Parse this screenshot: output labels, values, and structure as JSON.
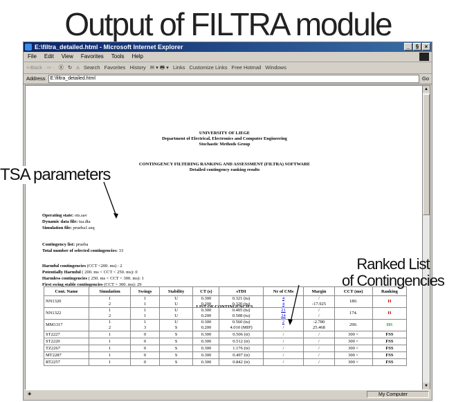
{
  "slide_title": "Output of FILTRA module",
  "window": {
    "title": "E:\\filtra_detailed.html - Microsoft Internet Explorer",
    "min": "_",
    "max": "§",
    "close": "×"
  },
  "menu": [
    "File",
    "Edit",
    "View",
    "Favorites",
    "Tools",
    "Help"
  ],
  "toolbar": {
    "back": "⇦Back · ⇨ ·",
    "stop": "Ⓧ",
    "refresh": "↻",
    "home": "⌂",
    "search": "Search",
    "favorites": "Favorites",
    "history": "History",
    "links": "Links",
    "customize": "Customize Links",
    "hotmail": "Free Hotmail",
    "windows": "Windows"
  },
  "address": {
    "label": "Address",
    "value": "E:\\filtra_detailed.html",
    "go": "Go"
  },
  "page": {
    "header1": "UNIVERSITY OF LIEGE",
    "header2": "Department of Electrical, Electronics and Computer Engineering",
    "header3": "Stochastic Methods Group",
    "software": "CONTINGENCY FILTERING RANKING AND ASSESSMENT (FILTRA) SOFTWARE",
    "subtitle": "Detailed contingency ranking results",
    "op_state_label": "Operating state:",
    "op_state_value": "ots.sav",
    "dyn_label": "Dynamic data file:",
    "dyn_value": "tsa.dta",
    "sim_label": "Simulation file:",
    "sim_value": "prueba1.seq",
    "cont_list_label": "Contingency list:",
    "cont_list_value": "prueba",
    "total_label": "Total number of selected contingencies:",
    "total_value": "33",
    "harmful_label": "Harmful contingencies",
    "harmful_rule": "(CCT  <200. ms) : 2",
    "pot_label": "Potentially Harmful",
    "pot_rule": "( 200. ms < CCT < 250. ms): 0",
    "harmless_label": "Harmless contingencies",
    "harmless_rule": "( 250. ms < CCT < 300. ms): 1",
    "first_label": "First swing stable contingencies",
    "first_rule": "(CCT > 300. ms): 29",
    "list_title": "LIST OF CONTINGENCIES"
  },
  "table": {
    "headers": [
      "Cont. Name",
      "Simulation",
      "Swings",
      "Stability",
      "CT (s)",
      "sTDI",
      "Nr of CMs",
      "Margin",
      "CCT (ms)",
      "Ranking"
    ],
    "rows": [
      {
        "name": "NN1320",
        "sim": [
          "1",
          "2"
        ],
        "sw": [
          "1",
          "1"
        ],
        "st": [
          "U",
          "U"
        ],
        "ct": [
          "0.300",
          "0.200"
        ],
        "stdi": [
          "0.321 (tu)",
          "0.320 (tu)"
        ],
        "cms": [
          "4",
          "4"
        ],
        "cms_link": true,
        "margin": [
          "/",
          "-17.925"
        ],
        "cct": "180.",
        "rank": "H",
        "rank_cls": "red"
      },
      {
        "name": "NN1322",
        "sim": [
          "1",
          "2"
        ],
        "sw": [
          "1",
          "1"
        ],
        "st": [
          "U",
          "U"
        ],
        "ct": [
          "0.300",
          "0.200"
        ],
        "stdi": [
          "0.405 (tu)",
          "0.508 (tu)"
        ],
        "cms": [
          "21",
          "24"
        ],
        "cms_link": true,
        "margin": [
          "/",
          "/"
        ],
        "cct": "174.",
        "rank": "H",
        "rank_cls": "red"
      },
      {
        "name": "MM1317",
        "sim": [
          "1",
          "2"
        ],
        "sw": [
          "1",
          "3"
        ],
        "st": [
          "U",
          "S"
        ],
        "ct": [
          "0.300",
          "0.200"
        ],
        "stdi": [
          "0.560 (tu)",
          "4.010 (MIP)"
        ],
        "cms": [
          "2",
          "/"
        ],
        "cms_link": true,
        "margin": [
          "-2.780",
          "25.468"
        ],
        "cct": "290.",
        "rank": "HS",
        "rank_cls": "green"
      },
      {
        "name": "ST2227",
        "sim": [
          "1"
        ],
        "sw": [
          "0"
        ],
        "st": [
          "S"
        ],
        "ct": [
          "0.300"
        ],
        "stdi": [
          "0.506 (tr)"
        ],
        "cms": [
          "/"
        ],
        "cms_link": false,
        "margin": [
          "/"
        ],
        "cct": "300 <",
        "rank": "FSS",
        "rank_cls": "blk"
      },
      {
        "name": "ST2220",
        "sim": [
          "1"
        ],
        "sw": [
          "0"
        ],
        "st": [
          "S"
        ],
        "ct": [
          "0.300"
        ],
        "stdi": [
          "0.512 (tr)"
        ],
        "cms": [
          "/"
        ],
        "cms_link": false,
        "margin": [
          "/"
        ],
        "cct": "300 <",
        "rank": "FSS",
        "rank_cls": "blk"
      },
      {
        "name": "TZ2267",
        "sim": [
          "1"
        ],
        "sw": [
          "0"
        ],
        "st": [
          "S"
        ],
        "ct": [
          "0.300"
        ],
        "stdi": [
          "1.176 (tr)"
        ],
        "cms": [
          "/"
        ],
        "cms_link": false,
        "margin": [
          "/"
        ],
        "cct": "300 <",
        "rank": "FSS",
        "rank_cls": "blk"
      },
      {
        "name": "MT2287",
        "sim": [
          "1"
        ],
        "sw": [
          "0"
        ],
        "st": [
          "S"
        ],
        "ct": [
          "0.300"
        ],
        "stdi": [
          "0.497 (tr)"
        ],
        "cms": [
          "/"
        ],
        "cms_link": false,
        "margin": [
          "/"
        ],
        "cct": "300 <",
        "rank": "FSS",
        "rank_cls": "blk"
      },
      {
        "name": "RT2257",
        "sim": [
          "1"
        ],
        "sw": [
          "0"
        ],
        "st": [
          "S"
        ],
        "ct": [
          "0.300"
        ],
        "stdi": [
          "0.842 (tr)"
        ],
        "cms": [
          "/"
        ],
        "cms_link": false,
        "margin": [
          "/"
        ],
        "cct": "300 <",
        "rank": "FSS",
        "rank_cls": "blk"
      }
    ]
  },
  "status": {
    "zone": "My Computer"
  },
  "annotations": {
    "tsa": "TSA parameters",
    "ranked1": "Ranked List",
    "ranked2": "of Contingencies"
  }
}
